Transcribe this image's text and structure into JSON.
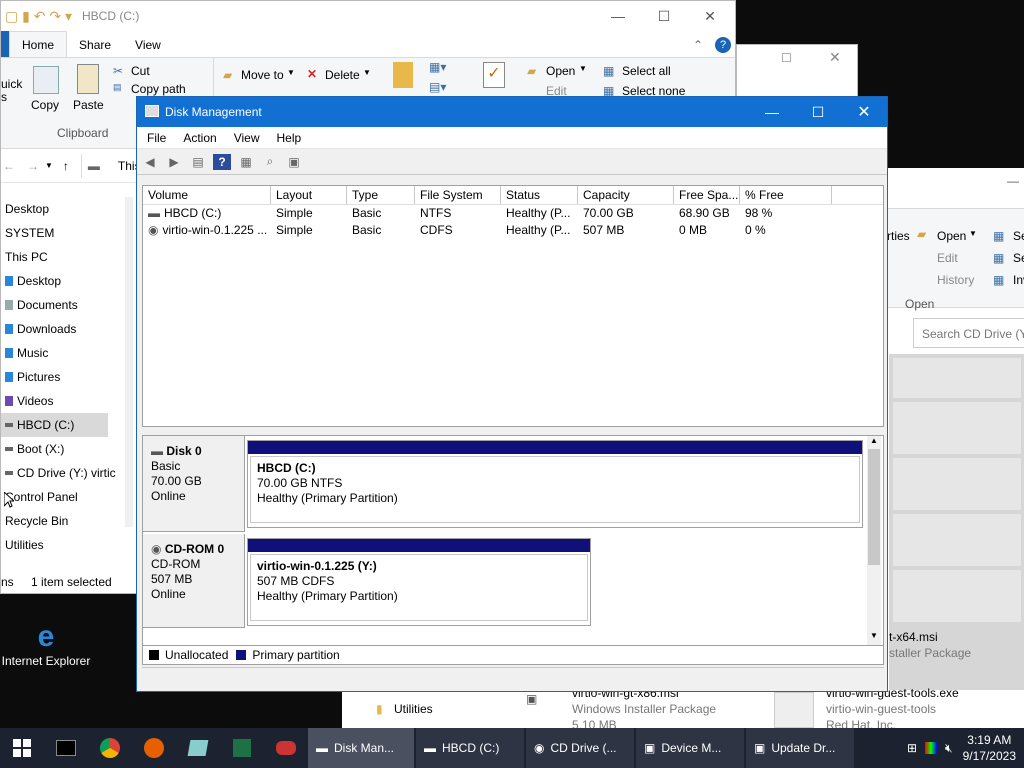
{
  "explorer": {
    "title": "HBCD (C:)",
    "tabs": [
      "Home",
      "Share",
      "View"
    ],
    "ribbon": {
      "quick": "uick",
      "quick2": "s",
      "copy": "Copy",
      "paste": "Paste",
      "cut": "Cut",
      "copy_path": "Copy path",
      "clipboard": "Clipboard",
      "move_to": "Move to",
      "delete": "Delete",
      "open": "Open",
      "edit": "Edit",
      "select_all": "Select all",
      "select_none": "Select none"
    },
    "address": "This PC",
    "sidebar": [
      "Desktop",
      "SYSTEM",
      "This PC",
      "Desktop",
      "Documents",
      "Downloads",
      "Music",
      "Pictures",
      "Videos",
      "HBCD (C:)",
      "Boot (X:)",
      "CD Drive (Y:) virtic",
      "Control Panel",
      "Recycle Bin",
      "Utilities"
    ],
    "status": "ns",
    "status_count": "1 item selected"
  },
  "explorer2": {
    "rties": "rties",
    "open": "Open",
    "edit": "Edit",
    "history": "History",
    "open_group": "Open",
    "se1": "Se",
    "se2": "Se",
    "inv": "Inv",
    "search_placeholder": "Search CD Drive (Y:)",
    "file1_name": "t-x64.msi",
    "file1_type": "staller Package",
    "utilities": "Utilities",
    "file2_name": "virtio-win-gt-x86.msi",
    "file2_type": "Windows Installer Package",
    "file2_size": "5.10 MB",
    "file3_name": "virtio-win-guest-tools.exe",
    "file3_desc": "virtio-win-guest-tools",
    "file3_company": "Red Hat, Inc."
  },
  "dm": {
    "title": "Disk Management",
    "menu": [
      "File",
      "Action",
      "View",
      "Help"
    ],
    "columns": [
      "Volume",
      "Layout",
      "Type",
      "File System",
      "Status",
      "Capacity",
      "Free Spa...",
      "% Free"
    ],
    "rows": [
      [
        "HBCD (C:)",
        "Simple",
        "Basic",
        "NTFS",
        "Healthy (P...",
        "70.00 GB",
        "68.90 GB",
        "98 %"
      ],
      [
        "virtio-win-0.1.225 ...",
        "Simple",
        "Basic",
        "CDFS",
        "Healthy (P...",
        "507 MB",
        "0 MB",
        "0 %"
      ]
    ],
    "disk0": {
      "name": "Disk 0",
      "type": "Basic",
      "size": "70.00 GB",
      "state": "Online",
      "part_name": "HBCD  (C:)",
      "part_size": "70.00 GB NTFS",
      "part_status": "Healthy (Primary Partition)"
    },
    "cdrom0": {
      "name": "CD-ROM 0",
      "type": "CD-ROM",
      "size": "507 MB",
      "state": "Online",
      "part_name": "virtio-win-0.1.225  (Y:)",
      "part_size": "507 MB CDFS",
      "part_status": "Healthy (Primary Partition)"
    },
    "legend": [
      "Unallocated",
      "Primary partition"
    ],
    "legend_colors": [
      "#000000",
      "#10107a"
    ]
  },
  "desktop": {
    "ie_label": "Internet Explorer"
  },
  "taskbar": {
    "apps": [
      "Disk Man...",
      "HBCD (C:)",
      "CD Drive (...",
      "Device M...",
      "Update Dr..."
    ],
    "time": "3:19 AM",
    "date": "9/17/2023"
  }
}
